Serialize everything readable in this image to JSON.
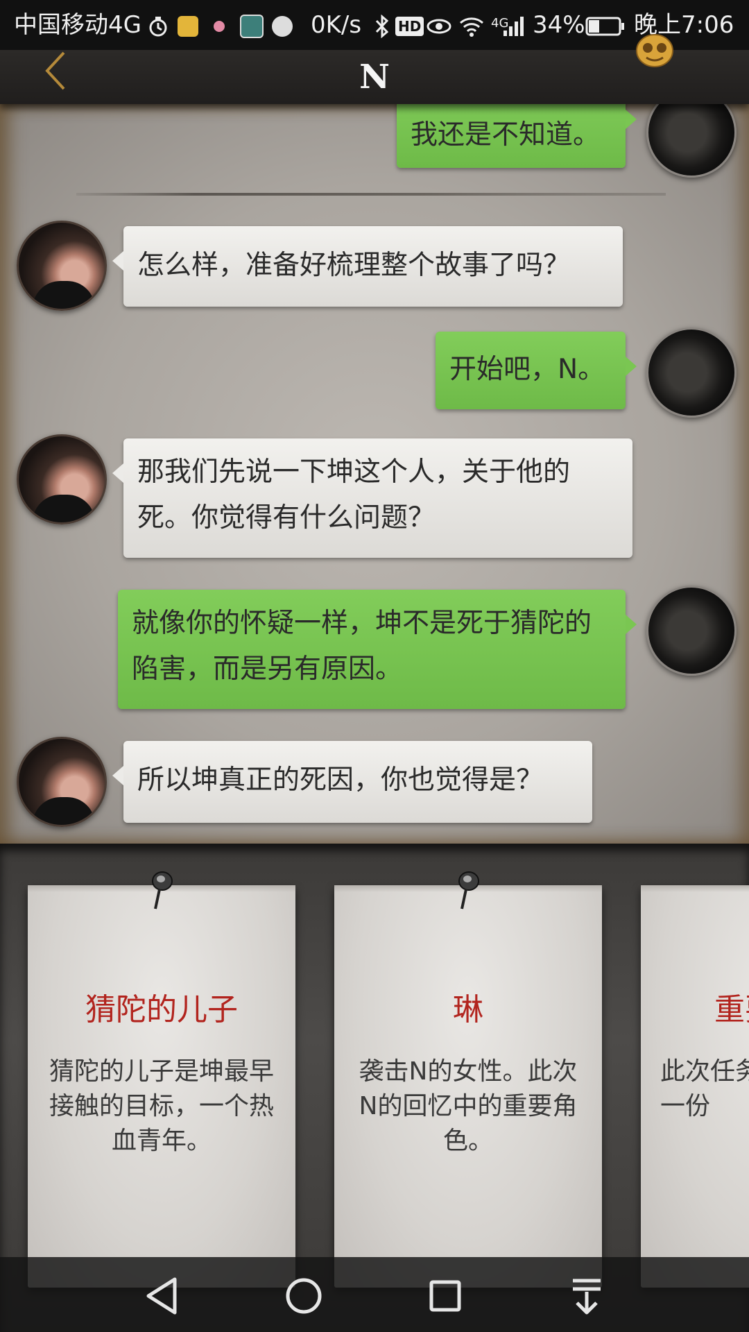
{
  "status_bar": {
    "carrier": "中国移动4G",
    "net_speed": "0K/s",
    "network_type": "4G",
    "battery": "34%",
    "time": "晚上7:06",
    "icons": [
      "alarm-icon",
      "star-badge-icon",
      "notification-dot-icon",
      "l-app-icon",
      "hand-app-icon",
      "bluetooth-icon",
      "hd-icon",
      "eye-icon",
      "wifi-icon",
      "signal-icon",
      "battery-icon"
    ]
  },
  "header": {
    "title": "N",
    "back_icon": "chevron-left-icon",
    "menu_icon": "mask-icon"
  },
  "messages": [
    {
      "sender": "user",
      "text": "我还是不知道。"
    },
    {
      "sender": "npc",
      "text": "怎么样，准备好梳理整个故事了吗？"
    },
    {
      "sender": "user",
      "text": "开始吧，N。"
    },
    {
      "sender": "npc",
      "text": "那我们先说一下坤这个人，关于他的死。你觉得有什么问题？"
    },
    {
      "sender": "user",
      "text": "就像你的怀疑一样，坤不是死于猜陀的陷害，而是另有原因。"
    },
    {
      "sender": "npc",
      "text": "所以坤真正的死因，你也觉得是？"
    }
  ],
  "cards": [
    {
      "title": "猜陀的儿子",
      "description": "猜陀的儿子是坤最早接触的目标，一个热血青年。"
    },
    {
      "title": "琳",
      "description": "袭击N的女性。此次N的回忆中的重要角色。"
    },
    {
      "title": "重要",
      "description": "此次任务收一份"
    }
  ],
  "nav_bar": {
    "icons": [
      "back-triangle-icon",
      "home-circle-icon",
      "recents-square-icon",
      "notification-pulldown-icon"
    ]
  },
  "colors": {
    "user_bubble": "#7ac652",
    "npc_bubble": "#ecebe8",
    "card_title": "#b2241e",
    "accent_gold": "#d9a43a"
  }
}
